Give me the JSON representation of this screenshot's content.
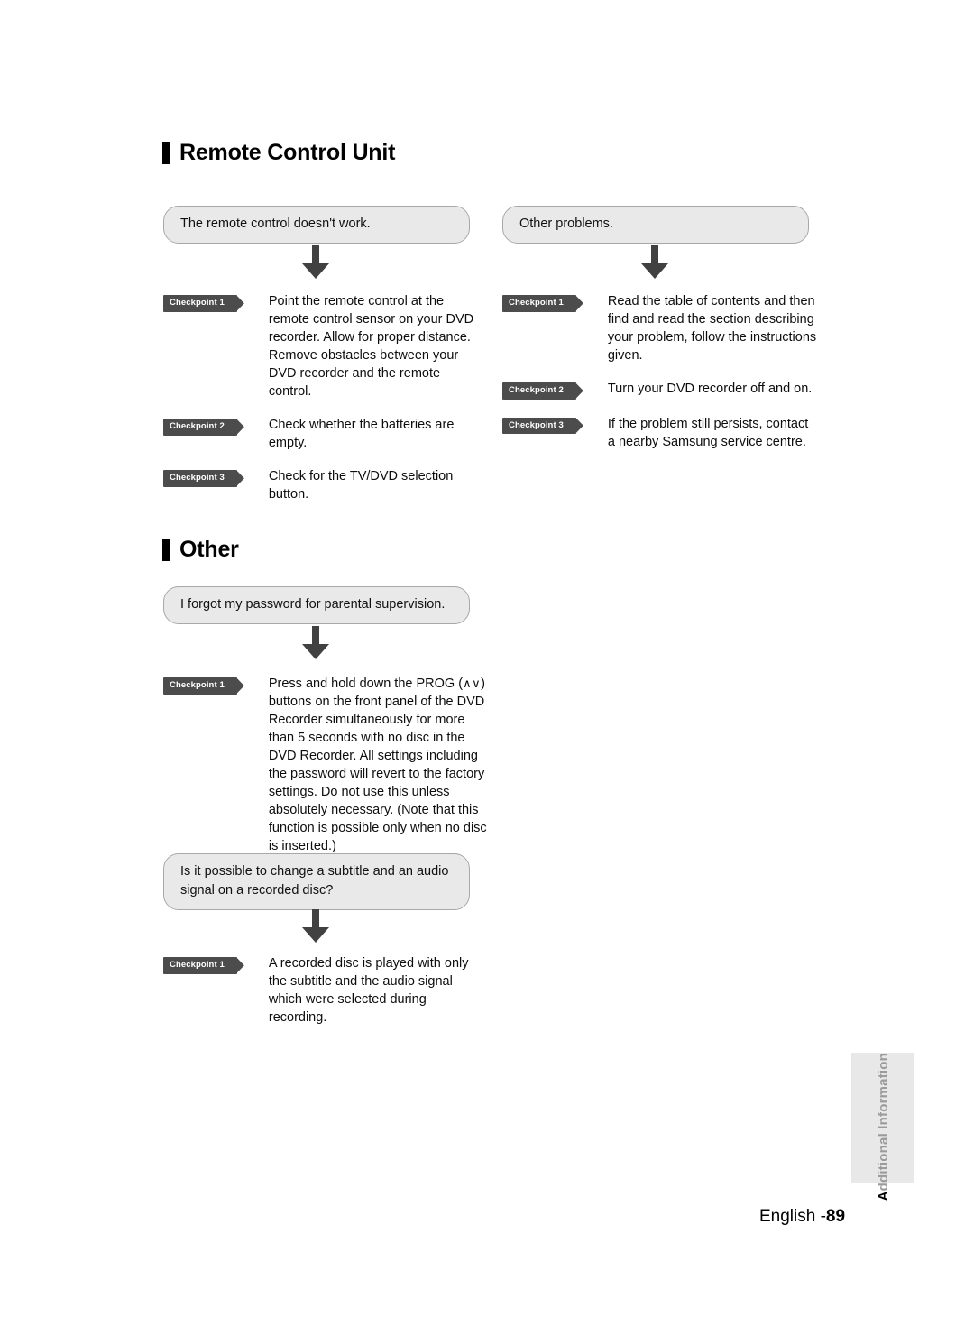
{
  "document": {
    "sections": [
      {
        "id": "remote-control-unit",
        "heading": "Remote Control Unit",
        "columns": [
          {
            "question": "The remote control doesn't work.",
            "arrow_icon": "down-arrow-icon",
            "checkpoints": [
              {
                "label": "Checkpoint 1",
                "text": "Point the remote control at the remote control sensor on your DVD recorder. Allow for proper distance. Remove obstacles between your DVD recorder and the remote control."
              },
              {
                "label": "Checkpoint 2",
                "text": "Check whether the batteries are empty."
              },
              {
                "label": "Checkpoint 3",
                "text": "Check for the TV/DVD selection button."
              }
            ]
          },
          {
            "question": "Other problems.",
            "arrow_icon": "down-arrow-icon",
            "checkpoints": [
              {
                "label": "Checkpoint 1",
                "text": "Read the table of contents and then find and read the section describing your problem, follow the instructions given."
              },
              {
                "label": "Checkpoint 2",
                "text": "Turn your DVD recorder off and on."
              },
              {
                "label": "Checkpoint 3",
                "text": "If the problem still persists, contact a nearby Samsung service centre."
              }
            ]
          }
        ]
      },
      {
        "id": "other",
        "heading": "Other",
        "blocks": [
          {
            "question": "I forgot my password for parental supervision.",
            "arrow_icon": "down-arrow-icon",
            "checkpoints": [
              {
                "label": "Checkpoint 1",
                "text_before": "Press and hold down the PROG (",
                "chevrons": "∧∨",
                "text_after": ") buttons on the front panel of the DVD Recorder simultaneously for more than 5 seconds with no disc in the DVD Recorder. All settings including the password will revert to the factory settings. Do not use this unless absolutely necessary. (Note that this function is possible only when no disc is inserted.)"
              }
            ]
          },
          {
            "question": "Is it possible to change a subtitle and an audio signal on a recorded disc?",
            "arrow_icon": "down-arrow-icon",
            "checkpoints": [
              {
                "label": "Checkpoint 1",
                "text": "A recorded disc is played with only the subtitle and the audio signal which were selected during recording."
              }
            ]
          }
        ]
      }
    ]
  },
  "side_tab": {
    "lead_letter": "A",
    "rest": "dditional Information"
  },
  "footer": {
    "language": "English -",
    "page_number": "89"
  },
  "colors": {
    "badge_background": "#4c4c4c",
    "question_background": "#e9e9e9",
    "question_border": "#a8a8a8",
    "arrow": "#414141",
    "side_tab_background": "#e8e8e8",
    "side_tab_text": "#9b9b9b"
  }
}
